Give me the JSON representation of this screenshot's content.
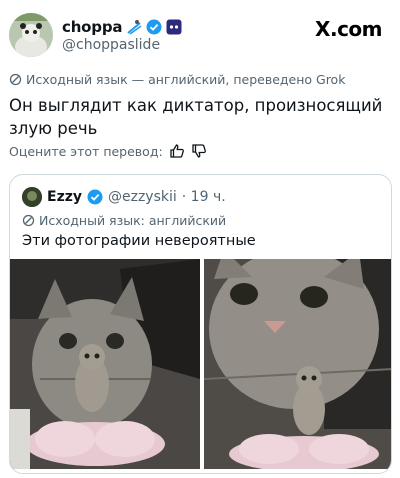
{
  "post": {
    "display_name": "choppa",
    "handle": "@choppaslide",
    "icons": [
      "ski-icon",
      "verified-badge-icon",
      "game-icon"
    ],
    "site_label": "X.com",
    "translation_note": "Исходный язык — английский, переведено Grok",
    "text": "Он выглядит как диктатор, произносящий злую речь",
    "rate_label": "Оцените этот перевод:"
  },
  "quote": {
    "display_name": "Ezzy",
    "handle": "@ezzyskii",
    "time": "· 19 ч.",
    "translation_note": "Исходный язык: английский",
    "text": "Эти фотографии невероятные"
  },
  "colors": {
    "verified": "#1d9bf0",
    "secondary_text": "#536471",
    "border": "#cfd9de"
  }
}
